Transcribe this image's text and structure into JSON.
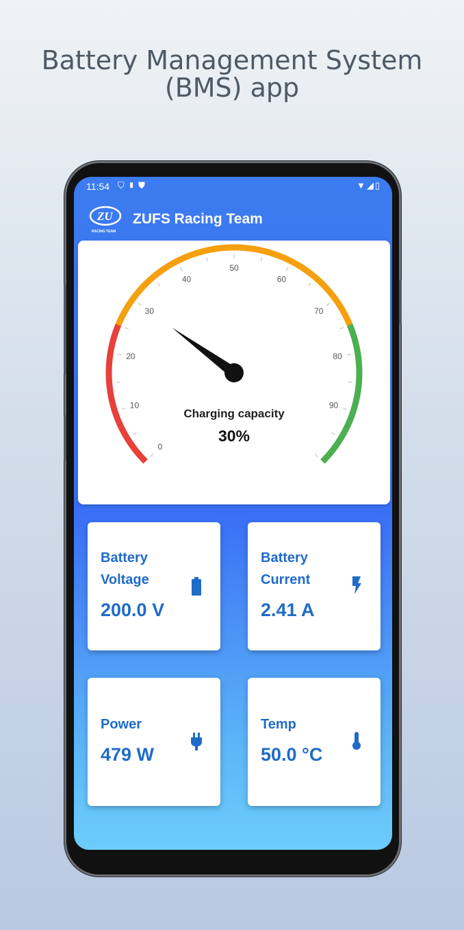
{
  "headline": {
    "line1": "Battery Management System",
    "line2": "(BMS) app"
  },
  "status_bar": {
    "time": "11:54",
    "left_icons": [
      "shield-icon",
      "sd-card-icon",
      "vpn-icon"
    ],
    "right_icons": [
      "wifi-icon",
      "signal-icon",
      "battery-icon"
    ]
  },
  "app_bar": {
    "logo_text": "ZU",
    "logo_subtext": "RACING TEAM",
    "title": "ZUFS Racing Team"
  },
  "gauge": {
    "caption": "Charging capacity",
    "value_text": "30%",
    "value": 30,
    "min": 0,
    "max": 100,
    "ticks": [
      "0",
      "10",
      "20",
      "30",
      "40",
      "50",
      "60",
      "70",
      "80",
      "90"
    ],
    "bands": [
      {
        "from": 0,
        "to": 25,
        "color": "#e8403a"
      },
      {
        "from": 25,
        "to": 75,
        "color": "#f5a00f"
      },
      {
        "from": 75,
        "to": 100,
        "color": "#4caf50"
      }
    ]
  },
  "tiles": [
    {
      "label1": "Battery",
      "label2": "Voltage",
      "value": "200.0 V",
      "icon": "battery-icon"
    },
    {
      "label1": "Battery",
      "label2": "Current",
      "value": "2.41 A",
      "icon": "bolt-icon"
    },
    {
      "label1": "Power",
      "label2": "",
      "value": "479 W",
      "icon": "plug-icon"
    },
    {
      "label1": "Temp",
      "label2": "",
      "value": "50.0 °C",
      "icon": "thermometer-icon"
    }
  ],
  "colors": {
    "accent_blue": "#1f6bc9",
    "app_bar": "#3c7bf0",
    "gauge_red": "#e8403a",
    "gauge_orange": "#f5a00f",
    "gauge_green": "#4caf50"
  }
}
